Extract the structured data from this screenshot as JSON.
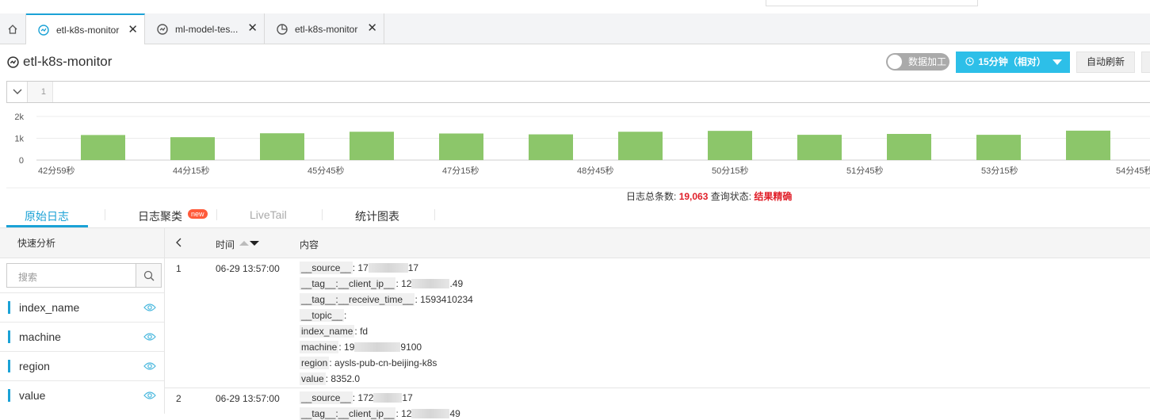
{
  "tabs": [
    {
      "label": "etl-k8s-monitor",
      "icon": "dashboard-icon",
      "active": true
    },
    {
      "label": "ml-model-tes...",
      "icon": "dashboard-icon",
      "active": false
    },
    {
      "label": "etl-k8s-monitor",
      "icon": "pie-chart-icon",
      "active": false
    }
  ],
  "header": {
    "title": "etl-k8s-monitor",
    "toggle_label": "数据加工",
    "time_range_label": "15分钟（相对）",
    "auto_refresh_label": "自动刷新"
  },
  "query": {
    "line_number": "1"
  },
  "chart_data": {
    "type": "bar",
    "yticks": [
      "2k",
      "1k",
      "0"
    ],
    "ylim": [
      0,
      2000
    ],
    "xtick_labels": [
      "42分59秒",
      "44分15秒",
      "45分45秒",
      "47分15秒",
      "48分45秒",
      "50分15秒",
      "51分45秒",
      "53分15秒",
      "54分45秒"
    ],
    "values": [
      1150,
      1050,
      1230,
      1300,
      1220,
      1180,
      1300,
      1340,
      1160,
      1200,
      1160,
      1350
    ],
    "bar_color": "#8cc66a",
    "grid": true
  },
  "summary": {
    "total_label": "日志总条数:",
    "total_value": "19,063",
    "status_label": "查询状态:",
    "status_value": "结果精确"
  },
  "lower_tabs": {
    "raw": "原始日志",
    "cluster": "日志聚类",
    "cluster_badge": "new",
    "livetail": "LiveTail",
    "stats": "统计图表"
  },
  "left_panel": {
    "title": "快速分析",
    "search_placeholder": "搜索",
    "fields": [
      "index_name",
      "machine",
      "region",
      "value"
    ]
  },
  "table": {
    "col_time": "时间",
    "col_content": "内容",
    "rows": [
      {
        "index": "1",
        "time": "06-29 13:57:00",
        "fields": [
          {
            "k": "__source__",
            "v1": "17",
            "v2": "17"
          },
          {
            "k": "__tag__:__client_ip__",
            "v1": "12",
            "v2": ".49"
          },
          {
            "k": "__tag__:__receive_time__",
            "v1": "1593410234",
            "v2": ""
          },
          {
            "k": "__topic__",
            "v1": "",
            "v2": ""
          },
          {
            "k": "index_name",
            "v1": "fd",
            "v2": ""
          },
          {
            "k": "machine",
            "v1": "19",
            "v2": "9100"
          },
          {
            "k": "region",
            "v1": "aysls-pub-cn-beijing-k8s",
            "v2": ""
          },
          {
            "k": "value",
            "v1": "8352.0",
            "v2": ""
          }
        ]
      },
      {
        "index": "2",
        "time": "06-29 13:57:00",
        "fields": [
          {
            "k": "__source__",
            "v1": "172",
            "v2": "17"
          },
          {
            "k": "__tag__:__client_ip__",
            "v1": "12",
            "v2": "49"
          }
        ]
      }
    ]
  }
}
